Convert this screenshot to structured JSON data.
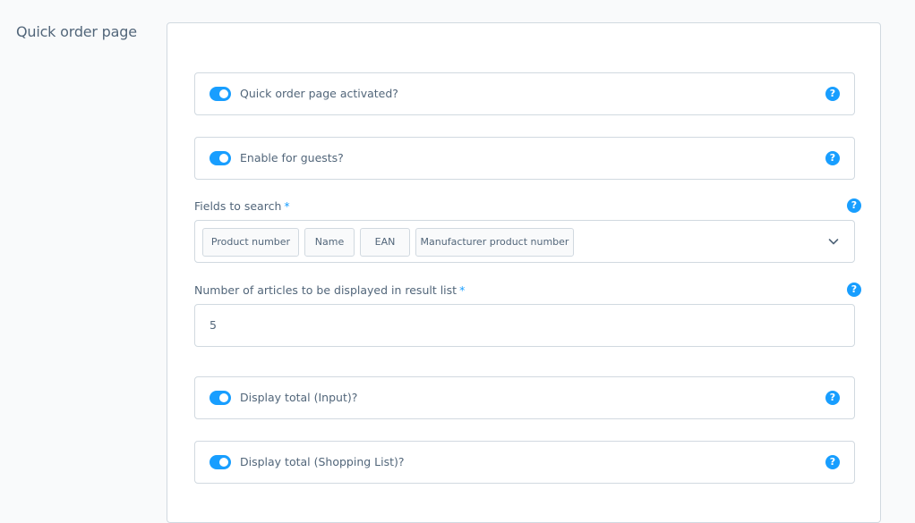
{
  "section": {
    "title": "Quick order page"
  },
  "settings": {
    "quick_order_activated": {
      "label": "Quick order page activated?",
      "enabled": true
    },
    "enable_for_guests": {
      "label": "Enable for guests?",
      "enabled": true
    },
    "fields_to_search": {
      "label": "Fields to search",
      "required_mark": "*",
      "tags": [
        "Product number",
        "Name",
        "EAN",
        "Manufacturer product number"
      ]
    },
    "articles_count": {
      "label": "Number of articles to be displayed in result list",
      "required_mark": "*",
      "value": "5"
    },
    "display_total_input": {
      "label": "Display total (Input)?",
      "enabled": true
    },
    "display_total_shopping_list": {
      "label": "Display total (Shopping List)?",
      "enabled": true
    }
  },
  "icons": {
    "help": "help-icon",
    "help_glyph": "?",
    "dropdown": "chevron-down-icon"
  },
  "colors": {
    "accent": "#189eff",
    "text": "#52667a",
    "border": "#d1d9e0",
    "background": "#f9fafb"
  }
}
